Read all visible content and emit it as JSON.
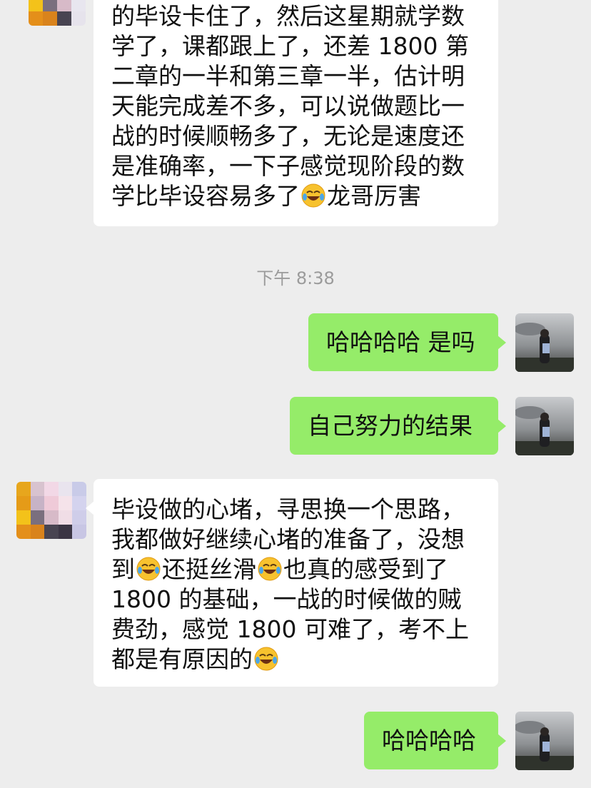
{
  "colors": {
    "background": "#ededed",
    "incoming_bubble": "#ffffff",
    "outgoing_bubble": "#95ec69",
    "timestamp_text": "#9b9b9b"
  },
  "messages": {
    "m1": {
      "line1": "的毕设卡住了，然后这星期就学数",
      "line2": "学了，课都跟上了，还差 1800 第",
      "line3": "二章的一半和第三章一半，估计明",
      "line4": "天能完成差不多，可以说做题比一",
      "line5": "战的时候顺畅多了，无论是速度还",
      "line6": "是准确率，一下子感觉现阶段的数",
      "line7a": "学比毕设容易多了",
      "line7b": "龙哥厉害"
    },
    "timestamp": "下午 8:38",
    "m2": {
      "text": "哈哈哈哈 是吗"
    },
    "m3": {
      "text": "自己努力的结果"
    },
    "m4": {
      "line1": "毕设做的心堵，寻思换一个思路，",
      "line2": "我都做好继续心堵的准备了，没想",
      "line3a": "到",
      "line3b": "还挺丝滑",
      "line3c": "也真的感受到了",
      "line4": "1800 的基础，一战的时候做的贼",
      "line5": "费劲，感觉 1800 可难了，考不上",
      "line6": "都是有原因的"
    },
    "m5": {
      "text": "哈哈哈哈"
    }
  },
  "icons": {
    "emoji": "crying-laughing-face-icon",
    "contact_avatar": "pixelated-avatar",
    "self_avatar": "photo-avatar-silhouette-at-dusk"
  }
}
